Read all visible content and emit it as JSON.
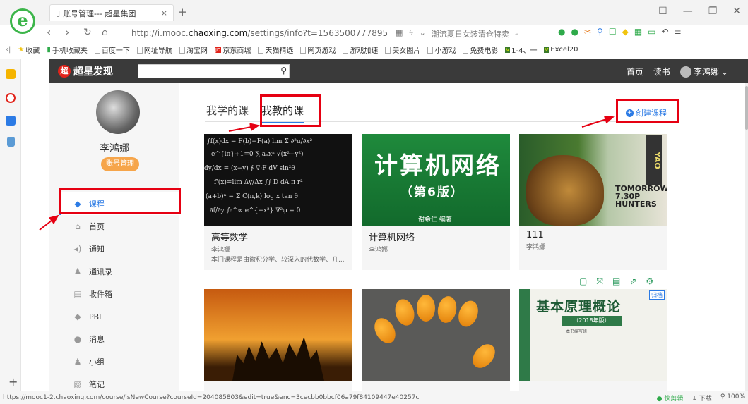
{
  "browser": {
    "tab_title": "账号管理--- 超星集团",
    "tab_close": "×",
    "new_tab": "+",
    "url_prefix": "http://i.mooc.",
    "url_domain": "chaoxing.com",
    "url_suffix": "/settings/info?t=1563500777895",
    "promo_text": "潮流夏日女装清仓特卖",
    "window_controls": [
      "☐",
      "—",
      "❐",
      "✕"
    ]
  },
  "bookmarks": [
    "收藏",
    "手机收藏夹",
    "百度一下",
    "网址导航",
    "淘宝网",
    "京东商城",
    "天猫精选",
    "网页游戏",
    "游戏加速",
    "美女图片",
    "小游戏",
    "免费电影",
    "1-4、一",
    "Excel20"
  ],
  "site": {
    "brand": "超星发现",
    "brand_mark": "超",
    "nav": [
      "首页",
      "读书"
    ],
    "user": "李鸿娜"
  },
  "profile": {
    "name": "李鸿娜",
    "account_button": "账号管理"
  },
  "menu": [
    {
      "label": "课程",
      "icon": "course-icon",
      "active": true
    },
    {
      "label": "首页",
      "icon": "home-icon"
    },
    {
      "label": "通知",
      "icon": "notice-icon"
    },
    {
      "label": "通讯录",
      "icon": "contacts-icon"
    },
    {
      "label": "收件箱",
      "icon": "inbox-icon"
    },
    {
      "label": "PBL",
      "icon": "pbl-icon"
    },
    {
      "label": "消息",
      "icon": "message-icon"
    },
    {
      "label": "小组",
      "icon": "group-icon"
    },
    {
      "label": "笔记",
      "icon": "notes-icon"
    }
  ],
  "main": {
    "tabs": [
      "我学的课",
      "我教的课"
    ],
    "selected_tab": "我教的课",
    "create_course": "创建课程"
  },
  "courses": [
    {
      "title": "高等数学",
      "teacher": "李鸿娜",
      "desc": "本门课程是由微积分学、较深入的代数学、几..."
    },
    {
      "title": "计算机网络",
      "teacher": "李鸿娜",
      "cover_title": "计算机网络",
      "cover_edition": "（第6版）",
      "cover_author": "谢希仁 编著"
    },
    {
      "title": "111",
      "teacher": "李鸿娜",
      "cover_text": "TOMORROW 7.30P HUNTERS",
      "cover_side": "YAO"
    },
    {
      "cover": "sunset-crowd"
    },
    {
      "cover": "bitter-gourd"
    },
    {
      "cover_title": "基本原理概论",
      "cover_year": "（2018年版）",
      "cover_editor": "本书编写组",
      "badge": "归档"
    }
  ],
  "status": {
    "url": "https://mooc1-2.chaoxing.com/course/isNewCourse?courseId=204085803&edit=true&enc=3cecbb0bbcf06a79f84109447e40257c",
    "right": [
      "快剪辑",
      "下载",
      "100%"
    ]
  },
  "colors": {
    "accent": "#2c7be5",
    "annotation": "#e60012",
    "header_bg": "#3a3a3a",
    "button_orange": "#f6a54a"
  }
}
